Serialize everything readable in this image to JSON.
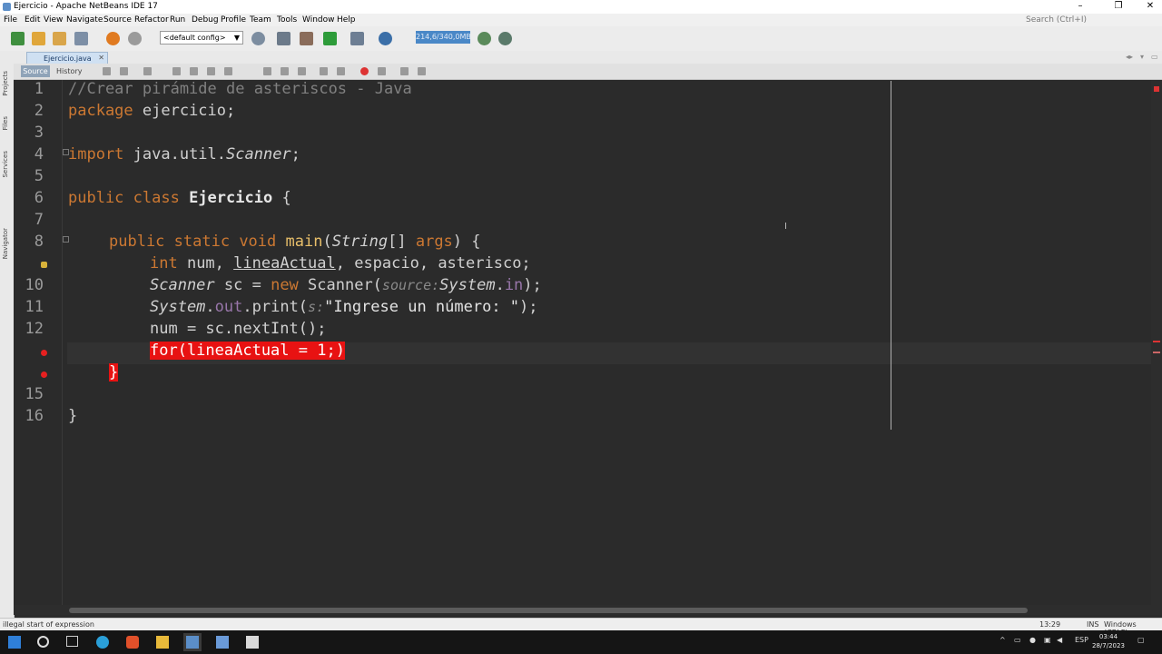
{
  "window": {
    "title": "Ejercicio - Apache NetBeans IDE 17"
  },
  "menu": {
    "file": "File",
    "edit": "Edit",
    "view": "View",
    "navigate": "Navigate",
    "source": "Source",
    "refactor": "Refactor",
    "run": "Run",
    "debug": "Debug",
    "profile": "Profile",
    "team": "Team",
    "tools": "Tools",
    "window": "Window",
    "help": "Help"
  },
  "search": {
    "placeholder": "Search (Ctrl+I)"
  },
  "toolbar": {
    "config": "<default config>",
    "memory": "214,6/340,0MB"
  },
  "side_tabs": {
    "projects": "Projects",
    "files": "Files",
    "services": "Services",
    "navigator": "Navigator"
  },
  "editor": {
    "tab_label": "Ejercicio.java",
    "source_label": "Source",
    "history_label": "History"
  },
  "lines": {
    "n1": "1",
    "n2": "2",
    "n3": "3",
    "n4": "4",
    "n5": "5",
    "n6": "6",
    "n7": "7",
    "n8": "8",
    "n10": "10",
    "n11": "11",
    "n12": "12",
    "n15": "15",
    "n16": "16"
  },
  "code": {
    "l1": "//Crear pirámide de asteriscos - Java",
    "l2_kw": "package",
    "l2_rest": " ejercicio;",
    "l4_kw": "import",
    "l4_a": " java.util.",
    "l4_b": "Scanner",
    "l4_c": ";",
    "l6_a": "public",
    "l6_b": " class ",
    "l6_c": "Ejercicio",
    "l6_d": " {",
    "l8_a": "public",
    "l8_b": " static",
    "l8_c": " void",
    "l8_d": " main",
    "l8_e": "(",
    "l8_f": "String",
    "l8_g": "[] ",
    "l8_h": "args",
    "l8_i": ") {",
    "l9_a": "int",
    "l9_b": " num, ",
    "l9_c": "lineaActual",
    "l9_d": ", espacio, asterisco;",
    "l10_a": "Scanner",
    "l10_b": " sc = ",
    "l10_c": "new",
    "l10_d": " Scanner(",
    "l10_e": "source:",
    "l10_f": "System",
    "l10_g": ".",
    "l10_h": "in",
    "l10_i": ");",
    "l11_a": "System",
    "l11_b": ".",
    "l11_c": "out",
    "l11_d": ".print(",
    "l11_e": "s:",
    "l11_f": "\"Ingrese un número: \"",
    "l11_g": ");",
    "l12": "num = sc.nextInt();",
    "l13": "for(lineaActual = 1;)",
    "l14": "}",
    "l16": "}"
  },
  "status": {
    "message": "illegal start of expression",
    "position": "13:29",
    "mode": "INS",
    "line_endings": "Windows (CRLF)"
  },
  "taskbar": {
    "lang": "ESP",
    "time": "03:44",
    "date": "28/7/2023"
  }
}
